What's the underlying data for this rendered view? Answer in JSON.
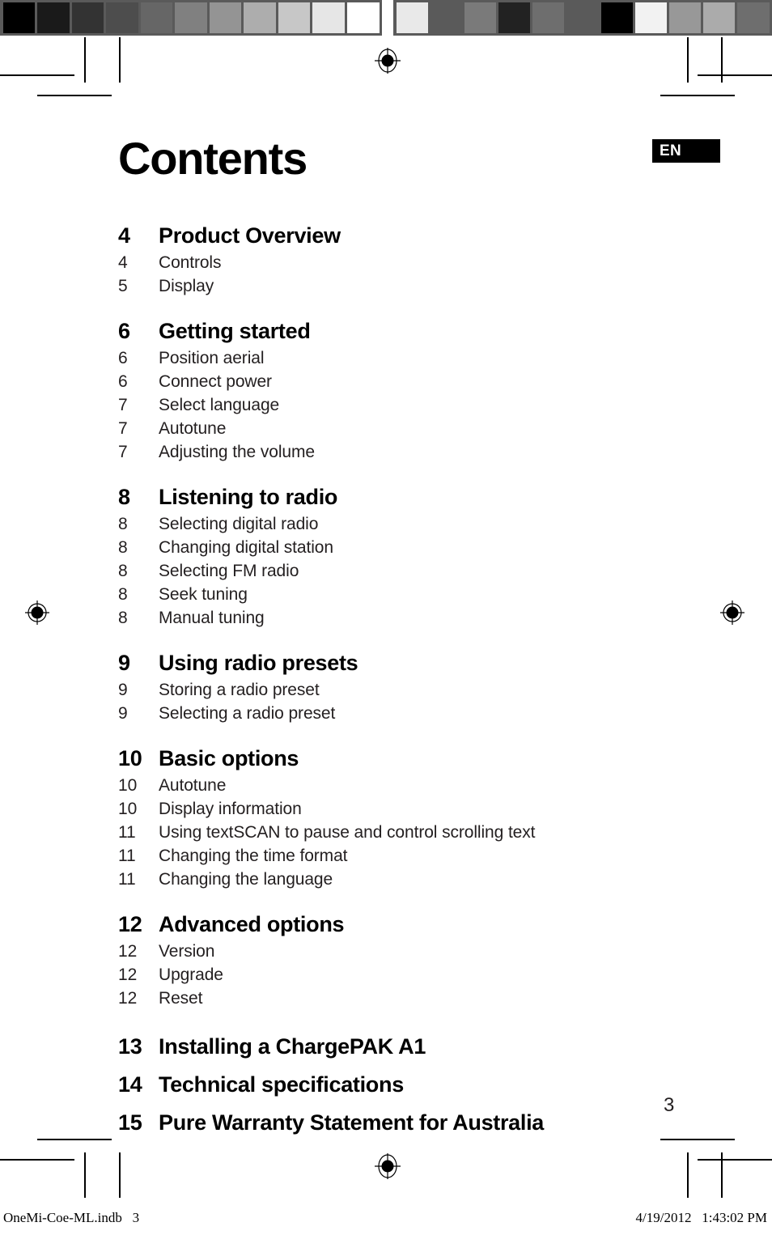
{
  "document": {
    "title": "Contents",
    "language_badge": "EN",
    "page_number": "3"
  },
  "calibration_strip": {
    "left_patches": [
      "#000000",
      "#1a1a1a",
      "#333333",
      "#4d4d4d",
      "#666666",
      "#808080",
      "#949494",
      "#adadad",
      "#c7c7c7",
      "#e6e6e6",
      "#ffffff"
    ],
    "right_patches": [
      "#e9e9e9",
      "#5a5a5a",
      "#7a7a7a",
      "#222222",
      "#6e6e6e",
      "#5a5a5a",
      "#000000",
      "#f2f2f2",
      "#989898",
      "#ababab",
      "#6e6e6e"
    ],
    "strip_background": "#5a5a5a"
  },
  "toc": {
    "sections": [
      {
        "number": "4",
        "title": "Product Overview",
        "items": [
          {
            "number": "4",
            "label": "Controls"
          },
          {
            "number": "5",
            "label": "Display"
          }
        ]
      },
      {
        "number": "6",
        "title": "Getting started",
        "items": [
          {
            "number": "6",
            "label": "Position aerial"
          },
          {
            "number": "6",
            "label": "Connect power"
          },
          {
            "number": "7",
            "label": "Select language"
          },
          {
            "number": "7",
            "label": "Autotune"
          },
          {
            "number": "7",
            "label": "Adjusting the volume"
          }
        ]
      },
      {
        "number": "8",
        "title": "Listening to radio",
        "items": [
          {
            "number": "8",
            "label": "Selecting digital radio"
          },
          {
            "number": "8",
            "label": "Changing digital station"
          },
          {
            "number": "8",
            "label": "Selecting FM radio"
          },
          {
            "number": "8",
            "label": "Seek tuning"
          },
          {
            "number": "8",
            "label": "Manual tuning"
          }
        ]
      },
      {
        "number": "9",
        "title": "Using radio presets",
        "items": [
          {
            "number": "9",
            "label": "Storing a radio preset"
          },
          {
            "number": "9",
            "label": "Selecting a radio preset"
          }
        ]
      },
      {
        "number": "10",
        "title": "Basic options",
        "items": [
          {
            "number": "10",
            "label": "Autotune"
          },
          {
            "number": "10",
            "label": "Display information"
          },
          {
            "number": "11",
            "label": "Using textSCAN to pause and control scrolling text"
          },
          {
            "number": "11",
            "label": "Changing the time format"
          },
          {
            "number": "11",
            "label": "Changing the language"
          }
        ]
      },
      {
        "number": "12",
        "title": "Advanced options",
        "items": [
          {
            "number": "12",
            "label": "Version"
          },
          {
            "number": "12",
            "label": "Upgrade"
          },
          {
            "number": "12",
            "label": "Reset"
          }
        ]
      }
    ],
    "standalone_entries": [
      {
        "number": "13",
        "label": "Installing a ChargePAK A1"
      },
      {
        "number": "14",
        "label": "Technical specifications"
      },
      {
        "number": "15",
        "label": "Pure Warranty Statement for Australia"
      }
    ]
  },
  "footer": {
    "filename": "OneMi-Coe-ML.indb   3",
    "timestamp": "4/19/2012   1:43:02 PM"
  }
}
